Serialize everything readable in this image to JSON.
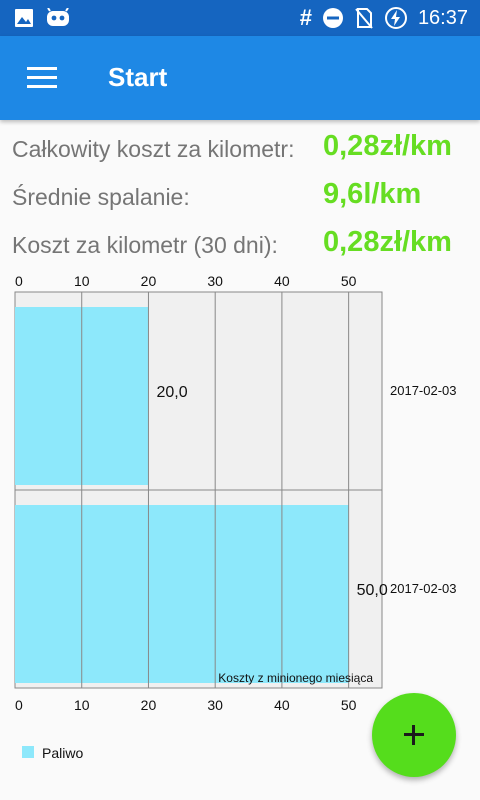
{
  "status_bar": {
    "time": "16:37",
    "hash_symbol": "#",
    "left_icons": [
      "image-icon",
      "android-face-icon"
    ],
    "right_icons": [
      "do-not-disturb-icon",
      "no-sim-icon",
      "battery-charging-icon"
    ]
  },
  "app_bar": {
    "title": "Start",
    "menu_icon": "hamburger-menu-icon"
  },
  "stats": [
    {
      "label": "Całkowity koszt za kilometr:",
      "value": "0,28zł/km"
    },
    {
      "label": "Średnie spalanie:",
      "value": "9,6l/km"
    },
    {
      "label": "Koszt za kilometr (30 dni):",
      "value": "0,28zł/km"
    }
  ],
  "chart_data": {
    "type": "bar",
    "orientation": "horizontal",
    "categories": [
      "2017-02-03",
      "2017-02-03"
    ],
    "series": [
      {
        "name": "Paliwo",
        "values": [
          20.0,
          50.0
        ],
        "color": "#8de8fb"
      }
    ],
    "value_labels": [
      "20,0",
      "50,0"
    ],
    "xlim": [
      0,
      55
    ],
    "tick_values": [
      0,
      10,
      20,
      30,
      40,
      50
    ],
    "tick_labels": [
      "0",
      "10",
      "20",
      "30",
      "40",
      "50"
    ],
    "description": "Koszty z minionego miesiąca",
    "grid": true,
    "legend_position": "bottom-left"
  },
  "colors": {
    "status_bar": "#1565c0",
    "app_bar": "#1e88e5",
    "accent_value": "#66dd22",
    "fab": "#55dd1c",
    "bar": "#8de8fb"
  },
  "fab": {
    "icon": "plus-icon"
  }
}
